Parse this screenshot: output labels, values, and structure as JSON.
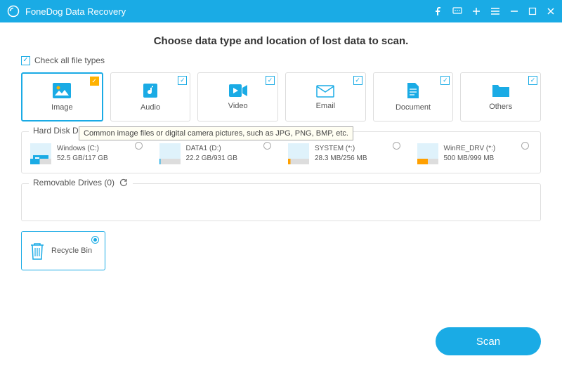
{
  "app": {
    "title": "FoneDog Data Recovery"
  },
  "headline": "Choose data type and location of lost data to scan.",
  "checkall_label": "Check all file types",
  "types": [
    {
      "label": "Image"
    },
    {
      "label": "Audio"
    },
    {
      "label": "Video"
    },
    {
      "label": "Email"
    },
    {
      "label": "Document"
    },
    {
      "label": "Others"
    }
  ],
  "tooltip": "Common image files or digital camera pictures, such as JPG, PNG, BMP, etc.",
  "hdd": {
    "title": "Hard Disk Drives (4)",
    "items": [
      {
        "name": "Windows (C:)",
        "size": "52.5 GB/117 GB",
        "fill": 0.45,
        "color": "#1aabe5",
        "icon": "win"
      },
      {
        "name": "DATA1 (D:)",
        "size": "22.2 GB/931 GB",
        "fill": 0.05,
        "color": "#1aabe5"
      },
      {
        "name": "SYSTEM (*:)",
        "size": "28.3 MB/256 MB",
        "fill": 0.12,
        "color": "#ffa000"
      },
      {
        "name": "WinRE_DRV (*:)",
        "size": "500 MB/999 MB",
        "fill": 0.5,
        "color": "#ffa000"
      }
    ]
  },
  "removable": {
    "title": "Removable Drives (0)"
  },
  "recycle_label": "Recycle Bin",
  "scan_label": "Scan"
}
